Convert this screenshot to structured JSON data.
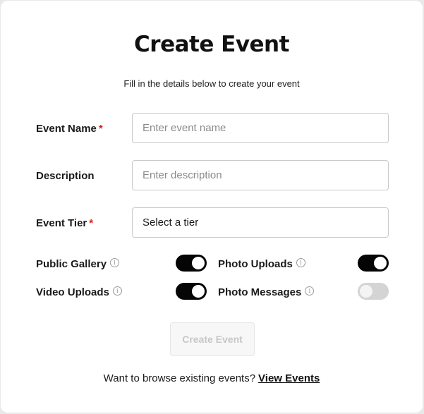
{
  "header": {
    "title": "Create Event",
    "subtitle": "Fill in the details below to create your event"
  },
  "form": {
    "event_name": {
      "label": "Event Name",
      "required_marker": "*",
      "value": "",
      "placeholder": "Enter event name"
    },
    "description": {
      "label": "Description",
      "value": "",
      "placeholder": "Enter description"
    },
    "event_tier": {
      "label": "Event Tier",
      "required_marker": "*",
      "selected": "Select a tier"
    }
  },
  "toggles": {
    "public_gallery": {
      "label": "Public Gallery",
      "info_icon": "ⓘ",
      "on": true
    },
    "photo_uploads": {
      "label": "Photo Uploads",
      "info_icon": "ⓘ",
      "on": true
    },
    "video_uploads": {
      "label": "Video Uploads",
      "info_icon": "ⓘ",
      "on": true
    },
    "photo_messages": {
      "label": "Photo Messages",
      "info_icon": "ⓘ",
      "on": false
    }
  },
  "actions": {
    "submit_label": "Create Event",
    "submit_disabled": true
  },
  "footer": {
    "prompt": "Want to browse existing events?",
    "link_label": "View Events"
  },
  "colors": {
    "accent": "#050505",
    "required": "#e01b1b",
    "toggle_off": "#d4d4d4",
    "disabled_button_bg": "#f7f7f7",
    "disabled_button_text": "#c7c7c7"
  }
}
